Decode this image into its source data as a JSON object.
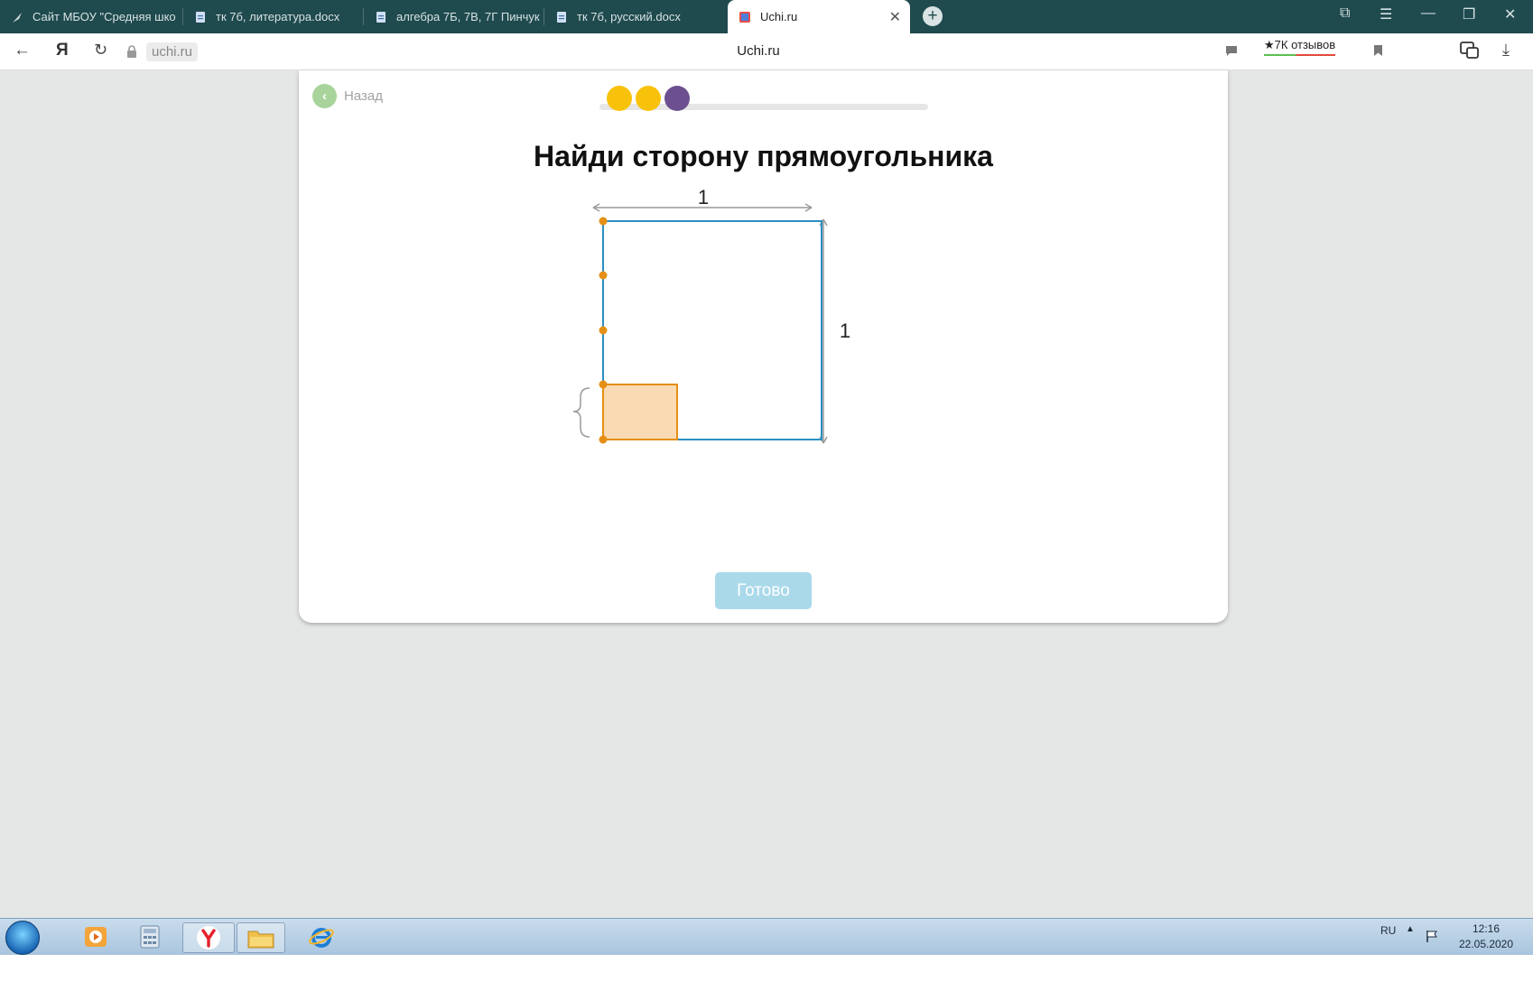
{
  "browser": {
    "tabs": [
      {
        "title": "Сайт МБОУ \"Средняя шко",
        "icon": "quill-icon"
      },
      {
        "title": "тк 7б, литература.docx",
        "icon": "document-icon"
      },
      {
        "title": "алгебра 7Б, 7В, 7Г Пинчук",
        "icon": "document-icon"
      },
      {
        "title": "тк 7б, русский.docx",
        "icon": "document-icon"
      },
      {
        "title": "Uchi.ru",
        "icon": "uchi-favicon-icon",
        "active": true
      }
    ],
    "new_tab_label": "+",
    "url": "uchi.ru",
    "page_title": "Uchi.ru",
    "reviews_label": "★7К отзывов"
  },
  "lesson": {
    "back_label": "Назад",
    "progress_dot_colors": [
      "#f9c20a",
      "#f9c20a",
      "#6c4f8f"
    ],
    "title": "Найди сторону прямоугольника",
    "width_label": "1",
    "height_label": "1",
    "fraction_numerator": "",
    "fraction_denominator": "",
    "done_label": "Готово",
    "colors": {
      "square_stroke": "#2a8fc2",
      "point": "#e58f16",
      "small_rect_fill": "#f9dab3",
      "small_rect_stroke": "#e58f16",
      "done_bg": "#aad9ea"
    }
  },
  "taskbar": {
    "language": "RU",
    "time": "12:16",
    "date": "22.05.2020"
  }
}
